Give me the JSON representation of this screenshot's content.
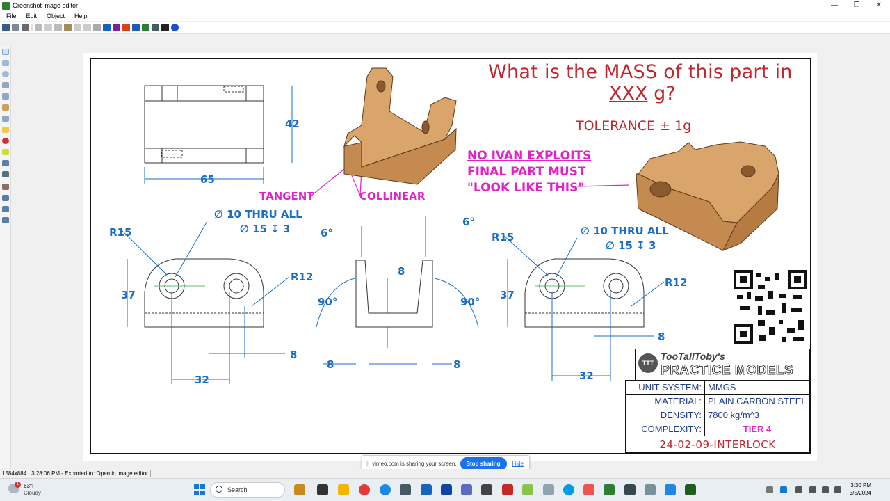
{
  "window": {
    "title": "Greenshot image editor",
    "controls": [
      "—",
      "❐",
      "✕"
    ]
  },
  "menu": [
    "File",
    "Edit",
    "Object",
    "Help"
  ],
  "drawing": {
    "question_line1": "What is the MASS of this part in",
    "question_unit": "XXX",
    "question_suffix": " g?",
    "tolerance": "TOLERANCE ± 1g",
    "notes": {
      "no_ivan": "NO IVAN EXPLOITS",
      "final_part": "FINAL PART MUST",
      "look_like": "\"LOOK LIKE THIS\"",
      "tangent": "TANGENT",
      "collinear": "COLLINEAR"
    },
    "dims": {
      "height_top": "42",
      "width_top": "65",
      "r15": "R15",
      "hole_thru": "∅ 10 THRU ALL",
      "hole_cbore": "∅ 15 ↧ 3",
      "r12": "R12",
      "height_front": "37",
      "dist_32": "32",
      "dist_8": "8",
      "angle_6": "6°",
      "angle_90": "90°"
    },
    "logo": {
      "line1": "TooTallToby's",
      "line2": "PRACTICE MODELS",
      "badge": "TTT"
    },
    "specs": [
      {
        "key": "UNIT SYSTEM:",
        "value": "MMGS"
      },
      {
        "key": "MATERIAL:",
        "value": "PLAIN CARBON STEEL"
      },
      {
        "key": "DENSITY:",
        "value": "7800 kg/m^3"
      },
      {
        "key": "COMPLEXITY:",
        "value": "TIER 4"
      }
    ],
    "part_number": "24-02-09-INTERLOCK"
  },
  "status": {
    "size": "1584x884",
    "message": "3:28:06 PM - Exported to: Open in image editor"
  },
  "share": {
    "grip": "||",
    "text": "vimeo.com is sharing your screen.",
    "stop": "Stop sharing",
    "hide": "Hide"
  },
  "taskbar": {
    "temp": "63°F",
    "condition": "Cloudy",
    "badge": "1",
    "search": "Search",
    "time": "3:30 PM",
    "date": "3/5/2024"
  },
  "colors": {
    "dimension_blue": "#1a6fc4",
    "title_red": "#c0262b",
    "note_magenta": "#e221c8",
    "part_tan": "#d9a56a"
  }
}
